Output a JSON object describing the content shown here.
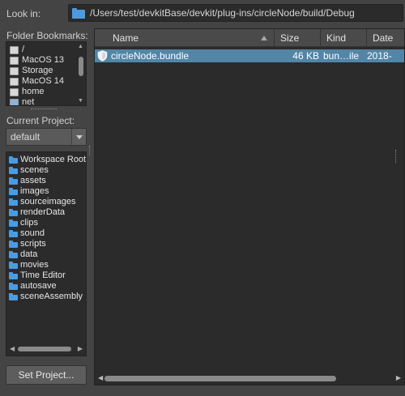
{
  "look_in": {
    "label": "Look in:",
    "path": "/Users/test/devkitBase/devkit/plug-ins/circleNode/build/Debug"
  },
  "bookmarks": {
    "label": "Folder Bookmarks:",
    "items": [
      {
        "label": "/",
        "icon": "drive-icon"
      },
      {
        "label": "MacOS 13",
        "icon": "drive-icon"
      },
      {
        "label": "Storage",
        "icon": "drive-icon"
      },
      {
        "label": "MacOS 14",
        "icon": "drive-icon"
      },
      {
        "label": "home",
        "icon": "drive-icon"
      },
      {
        "label": "net",
        "icon": "network-drive-icon"
      }
    ]
  },
  "project": {
    "label": "Current Project:",
    "selected": "default"
  },
  "project_folders": [
    "Workspace Root",
    "scenes",
    "assets",
    "images",
    "sourceimages",
    "renderData",
    "clips",
    "sound",
    "scripts",
    "data",
    "movies",
    "Time Editor",
    "autosave",
    "sceneAssembly"
  ],
  "set_project_button": "Set Project...",
  "file_list": {
    "columns": [
      "Name",
      "Size",
      "Kind",
      "Date"
    ],
    "rows": [
      {
        "name": "circleNode.bundle",
        "size": "46 KB",
        "kind": "bun…ile",
        "date": "2018-"
      }
    ]
  },
  "colors": {
    "background": "#444444",
    "field": "#2b2b2b",
    "selection": "#5285a6",
    "folder": "#4c9be0"
  }
}
